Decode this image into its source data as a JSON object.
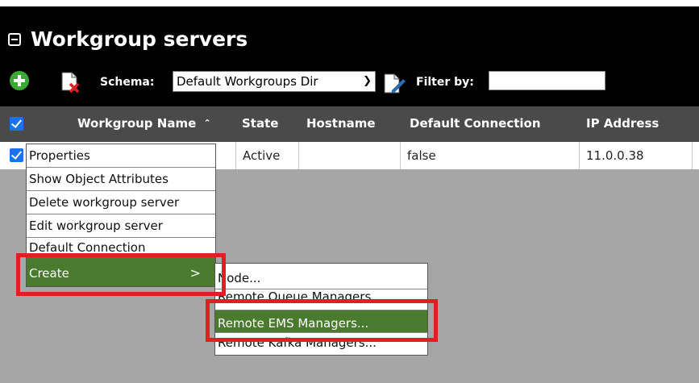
{
  "header": {
    "title": "Workgroup servers",
    "schema_label": "Schema:",
    "schema_value": "Default Workgroups Dir",
    "filter_label": "Filter by:",
    "filter_value": ""
  },
  "table": {
    "columns": [
      "Workgroup Name",
      "State",
      "Hostname",
      "Default Connection",
      "IP Address"
    ],
    "sort_indicator": "^",
    "rows": [
      {
        "name": "",
        "state": "Active",
        "hostname": "",
        "default_connection": "false",
        "ip": "11.0.0.38",
        "checked": true
      }
    ]
  },
  "context_menu": {
    "items": [
      "Properties",
      "Show Object Attributes",
      "Delete workgroup server",
      "Edit workgroup server",
      "Default Connection",
      "Create"
    ],
    "create_arrow": ">"
  },
  "submenu": {
    "items": [
      "Node...",
      "Remote Queue Managers...",
      "Remote EMS Managers...",
      "Remote Kafka Managers..."
    ]
  },
  "colors": {
    "header_bg": "#000000",
    "column_header_bg": "#4a4a4a",
    "highlight": "#4a7a2e",
    "annotation": "#e02020",
    "checkbox": "#1a73e8"
  }
}
